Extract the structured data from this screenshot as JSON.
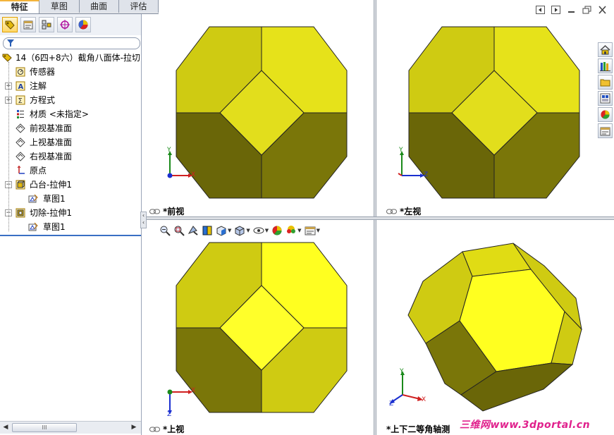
{
  "tabs": [
    {
      "label": "特征",
      "active": true
    },
    {
      "label": "草图",
      "active": false
    },
    {
      "label": "曲面",
      "active": false
    },
    {
      "label": "评估",
      "active": false
    }
  ],
  "tree": {
    "root": "14（6四+8六）截角八面体-拉切",
    "items": [
      {
        "label": "传感器",
        "icon": "sensor-icon"
      },
      {
        "label": "注解",
        "icon": "annotation-icon"
      },
      {
        "label": "方程式",
        "icon": "equation-icon"
      },
      {
        "label": "材质 <未指定>",
        "icon": "material-icon"
      },
      {
        "label": "前视基准面",
        "icon": "plane-icon"
      },
      {
        "label": "上视基准面",
        "icon": "plane-icon"
      },
      {
        "label": "右视基准面",
        "icon": "plane-icon"
      },
      {
        "label": "原点",
        "icon": "origin-icon"
      },
      {
        "label": "凸台-拉伸1",
        "icon": "boss-extrude-icon"
      },
      {
        "label": "草图1",
        "icon": "sketch-icon"
      },
      {
        "label": "切除-拉伸1",
        "icon": "cut-extrude-icon"
      },
      {
        "label": "草图1",
        "icon": "sketch-icon"
      }
    ]
  },
  "viewports": {
    "front": "*前视",
    "left": "*左视",
    "top": "*上视",
    "iso": "*上下二等角轴测"
  },
  "axes": {
    "x": "X",
    "y": "Y",
    "z": "Z"
  },
  "more_glyph": "»",
  "scroll_thumb": "III",
  "watermark": "三维网www.3dportal.cn",
  "colors": {
    "light": "#e6e21a",
    "mid": "#cfcb12",
    "dark": "#7a7609",
    "darker": "#6a6608",
    "bright": "#ffff20"
  }
}
